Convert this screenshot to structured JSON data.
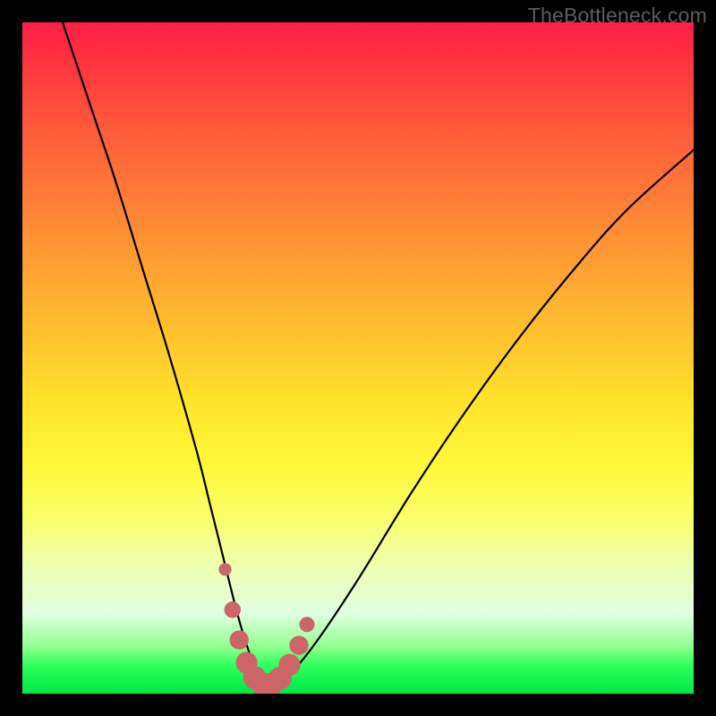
{
  "watermark": "TheBottleneck.com",
  "chart_data": {
    "type": "line",
    "title": "",
    "xlabel": "",
    "ylabel": "",
    "xlim": [
      0,
      100
    ],
    "ylim": [
      0,
      100
    ],
    "series": [
      {
        "name": "bottleneck-curve",
        "x": [
          6,
          10,
          14,
          18,
          22,
          26,
          28,
          30,
          32,
          33.5,
          35,
          36.5,
          38,
          40,
          44,
          50,
          58,
          66,
          74,
          82,
          90,
          100
        ],
        "values": [
          100,
          88,
          76,
          63,
          50,
          36,
          28,
          20,
          12,
          7,
          3,
          1.5,
          1.5,
          3,
          8,
          17,
          30,
          42,
          53,
          63,
          72,
          81
        ]
      }
    ],
    "markers": {
      "name": "highlight-dots",
      "color": "#cc6666",
      "points": [
        {
          "x": 30.2,
          "y": 18.5,
          "r": 1.0
        },
        {
          "x": 31.3,
          "y": 12.5,
          "r": 1.3
        },
        {
          "x": 32.3,
          "y": 8.0,
          "r": 1.5
        },
        {
          "x": 33.4,
          "y": 4.6,
          "r": 1.7
        },
        {
          "x": 34.6,
          "y": 2.4,
          "r": 1.8
        },
        {
          "x": 35.8,
          "y": 1.4,
          "r": 1.8
        },
        {
          "x": 37.1,
          "y": 1.4,
          "r": 1.8
        },
        {
          "x": 38.4,
          "y": 2.3,
          "r": 1.8
        },
        {
          "x": 39.8,
          "y": 4.3,
          "r": 1.7
        },
        {
          "x": 41.2,
          "y": 7.2,
          "r": 1.5
        },
        {
          "x": 42.4,
          "y": 10.3,
          "r": 1.2
        }
      ]
    }
  }
}
